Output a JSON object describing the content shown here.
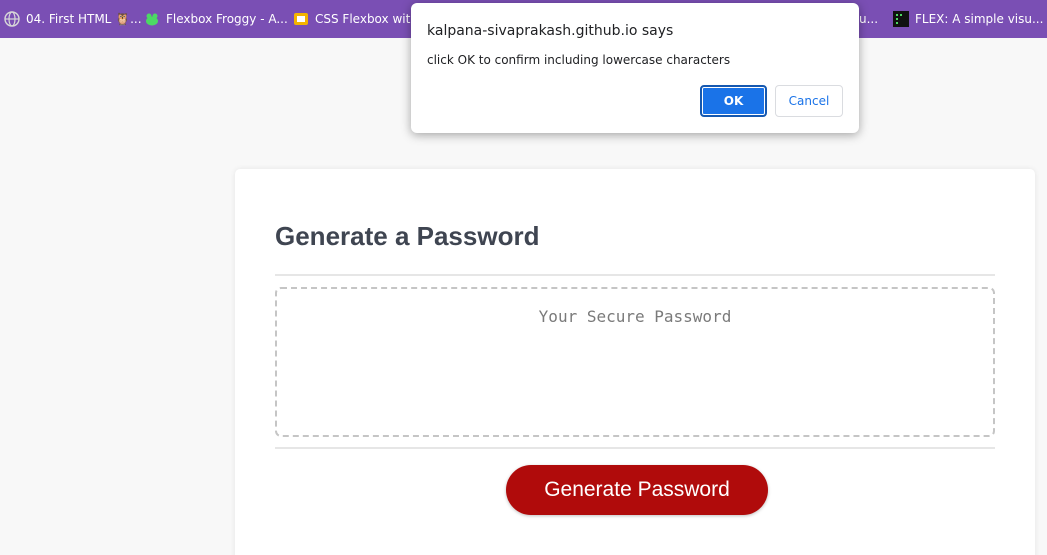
{
  "bookmarks": [
    {
      "icon": "globe-icon",
      "label": "04. First HTML 🦉..."
    },
    {
      "icon": "frog-icon",
      "label": "Flexbox Froggy - A..."
    },
    {
      "icon": "slides-icon",
      "label": "CSS Flexbox with C"
    },
    {
      "icon": "page-icon",
      "label": "u..."
    },
    {
      "icon": "grid-icon",
      "label": "FLEX: A simple visu..."
    }
  ],
  "dialog": {
    "title": "kalpana-sivaprakash.github.io says",
    "message": "click OK to confirm including lowercase characters",
    "ok_label": "OK",
    "cancel_label": "Cancel"
  },
  "card": {
    "title": "Generate a Password",
    "password_placeholder": "Your Secure Password",
    "password_value": "",
    "generate_label": "Generate Password"
  },
  "colors": {
    "bookmark_bar": "#7a4fb4",
    "generate_button": "#b00b0b",
    "ok_button": "#1a73e8"
  }
}
